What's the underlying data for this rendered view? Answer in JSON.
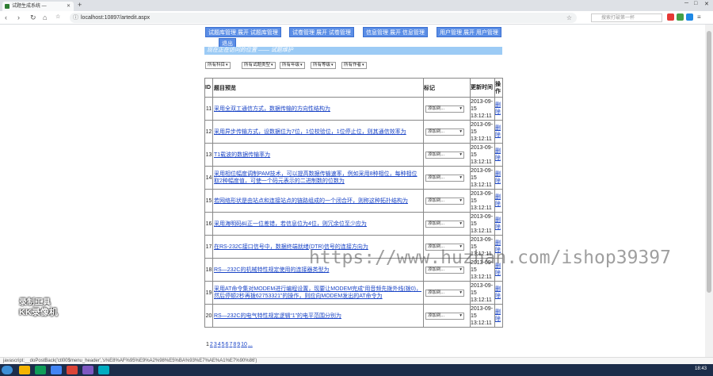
{
  "browser": {
    "tab_title": "试题生成系统 —",
    "url": "localhost:10897/artedit.aspx",
    "side_search_placeholder": "搜索打破第一杯",
    "status_text": "javascript:__doPostBack('ctl00$menu_header','s%E8%AF%95%E9%A2%98%E5%BA%93%E7%AE%A1%E7%90%86')"
  },
  "menu": {
    "items": [
      {
        "label": "试题库管理 展开 试题库管理"
      },
      {
        "label": "试卷管理 展开 试卷管理"
      },
      {
        "label": "信息管理 展开 信息管理"
      },
      {
        "label": "用户管理 展开 用户管理"
      },
      {
        "label": "退出"
      }
    ]
  },
  "status_line": "现在正在访问的位置 —— 试题维护",
  "filters": [
    "所有科目",
    "所有试题类型",
    "所有年级",
    "所有等级",
    "所有作者"
  ],
  "table": {
    "headers": {
      "id": "ID",
      "preview": "题目预览",
      "mark": "标记",
      "updated": "更新时间",
      "action": "操作"
    },
    "mark_default": "添加到...",
    "action_label": "删除",
    "rows": [
      {
        "id": "11",
        "text": "采用全双工通信方式，数据传输的方向性结构为",
        "date": "2013-09-15",
        "time": "13:12:11"
      },
      {
        "id": "12",
        "text": "采用异步传输方式，设数据位为7位，1位校验位，1位停止位，则其通信效率为",
        "date": "2013-09-15",
        "time": "13:12:11"
      },
      {
        "id": "13",
        "text": "T1载波的数据传输率为",
        "date": "2013-09-15",
        "time": "13:12:11"
      },
      {
        "id": "14",
        "text": "采用相位幅度调制PAM技术，可以提高数据传输速率，例如采用8种相位，每种相位取2种幅度值，可使一个码元表示的二进制数的位数为",
        "date": "2013-09-15",
        "time": "13:12:11"
      },
      {
        "id": "15",
        "text": "若网络形状是由站点和连接站点的链路组成的一个闭合环，则称这种拓扑结构为",
        "date": "2013-09-15",
        "time": "13:12:11"
      },
      {
        "id": "16",
        "text": "采用海明码纠正一位差错，若信息位为4位，则冗余位至少应为",
        "date": "2013-09-15",
        "time": "13:12:11"
      },
      {
        "id": "17",
        "text": "在RS-232C接口信号中，数据终端就绪(DTR)信号的连接方向为",
        "date": "2013-09-15",
        "time": "13:12:11"
      },
      {
        "id": "18",
        "text": "RS—232C的机械特性规定使用的连接器类型为",
        "date": "2013-09-15",
        "time": "13:12:11"
      },
      {
        "id": "19",
        "text": "采用AT命令集对MODEM进行编程设置，现要让MODEM完成“用音频先拨外线(拨0)，然后停顿2秒再拨62753321”的操作，则应向MODEM发出的AT命令为",
        "date": "2013-09-15",
        "time": "13:12:11"
      },
      {
        "id": "20",
        "text": "RS—232C的电气特性规定逻辑“1”的电平范围分别为",
        "date": "2013-09-15",
        "time": "13:12:11"
      }
    ]
  },
  "pager": [
    "1",
    "2",
    "3",
    "4",
    "5",
    "6",
    "7",
    "8",
    "9",
    "10",
    "..."
  ],
  "watermark": "https://www.huzhan.com/ishop39397",
  "record_logo": [
    "录制工具",
    "KK录像机"
  ],
  "clock": "18:43"
}
